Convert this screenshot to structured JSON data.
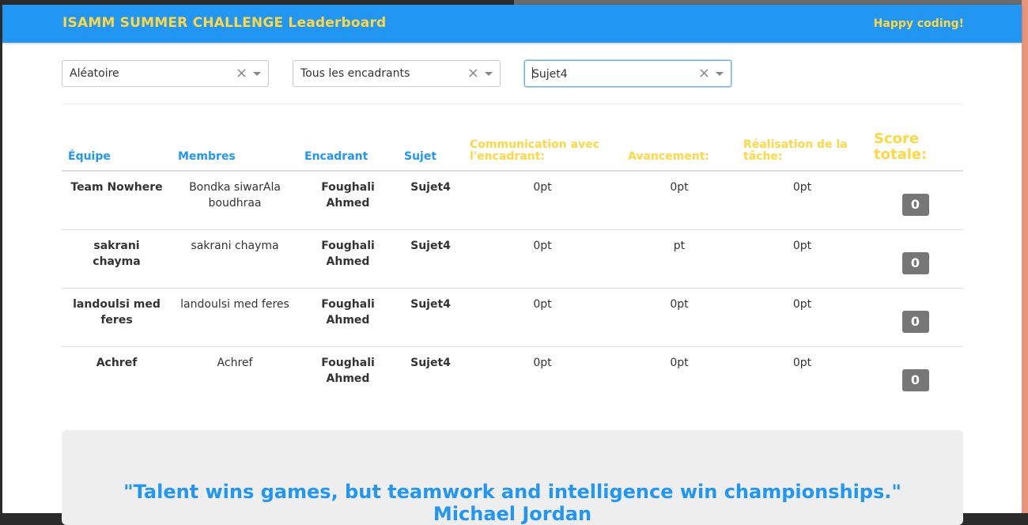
{
  "navbar": {
    "brand": "ISAMM SUMMER CHALLENGE Leaderboard",
    "tagline": "Happy coding!"
  },
  "filters": {
    "order": "Aléatoire",
    "supervisor": "Tous les encadrants",
    "subject": "Sujet4",
    "clear_symbol": "×"
  },
  "table": {
    "headers": {
      "team": "Équipe",
      "members": "Membres",
      "supervisor": "Encadrant",
      "subject": "Sujet",
      "communication": "Communication avec l'encadrant:",
      "progress": "Avancement:",
      "realisation": "Réalisation de la tâche:",
      "total": "Score totale:"
    },
    "rows": [
      {
        "team": "Team Nowhere",
        "members": "Bondka siwarAla boudhraa",
        "supervisor": "Foughali Ahmed",
        "subject": "Sujet4",
        "communication": "0pt",
        "progress": "0pt",
        "realisation": "0pt",
        "total": "0"
      },
      {
        "team": "sakrani chayma",
        "members": "sakrani chayma",
        "supervisor": "Foughali Ahmed",
        "subject": "Sujet4",
        "communication": "0pt",
        "progress": "pt",
        "realisation": "0pt",
        "total": "0"
      },
      {
        "team": "landoulsi med feres",
        "members": "landoulsi med feres",
        "supervisor": "Foughali Ahmed",
        "subject": "Sujet4",
        "communication": "0pt",
        "progress": "0pt",
        "realisation": "0pt",
        "total": "0"
      },
      {
        "team": "Achref",
        "members": "Achref",
        "supervisor": "Foughali Ahmed",
        "subject": "Sujet4",
        "communication": "0pt",
        "progress": "0pt",
        "realisation": "0pt",
        "total": "0"
      }
    ]
  },
  "quote": {
    "text": "\"Talent wins games, but teamwork and intelligence win championships.\"",
    "author": "Michael Jordan"
  },
  "colors": {
    "primary": "#2196f3",
    "accent": "#ffd740",
    "badge": "#777777"
  }
}
